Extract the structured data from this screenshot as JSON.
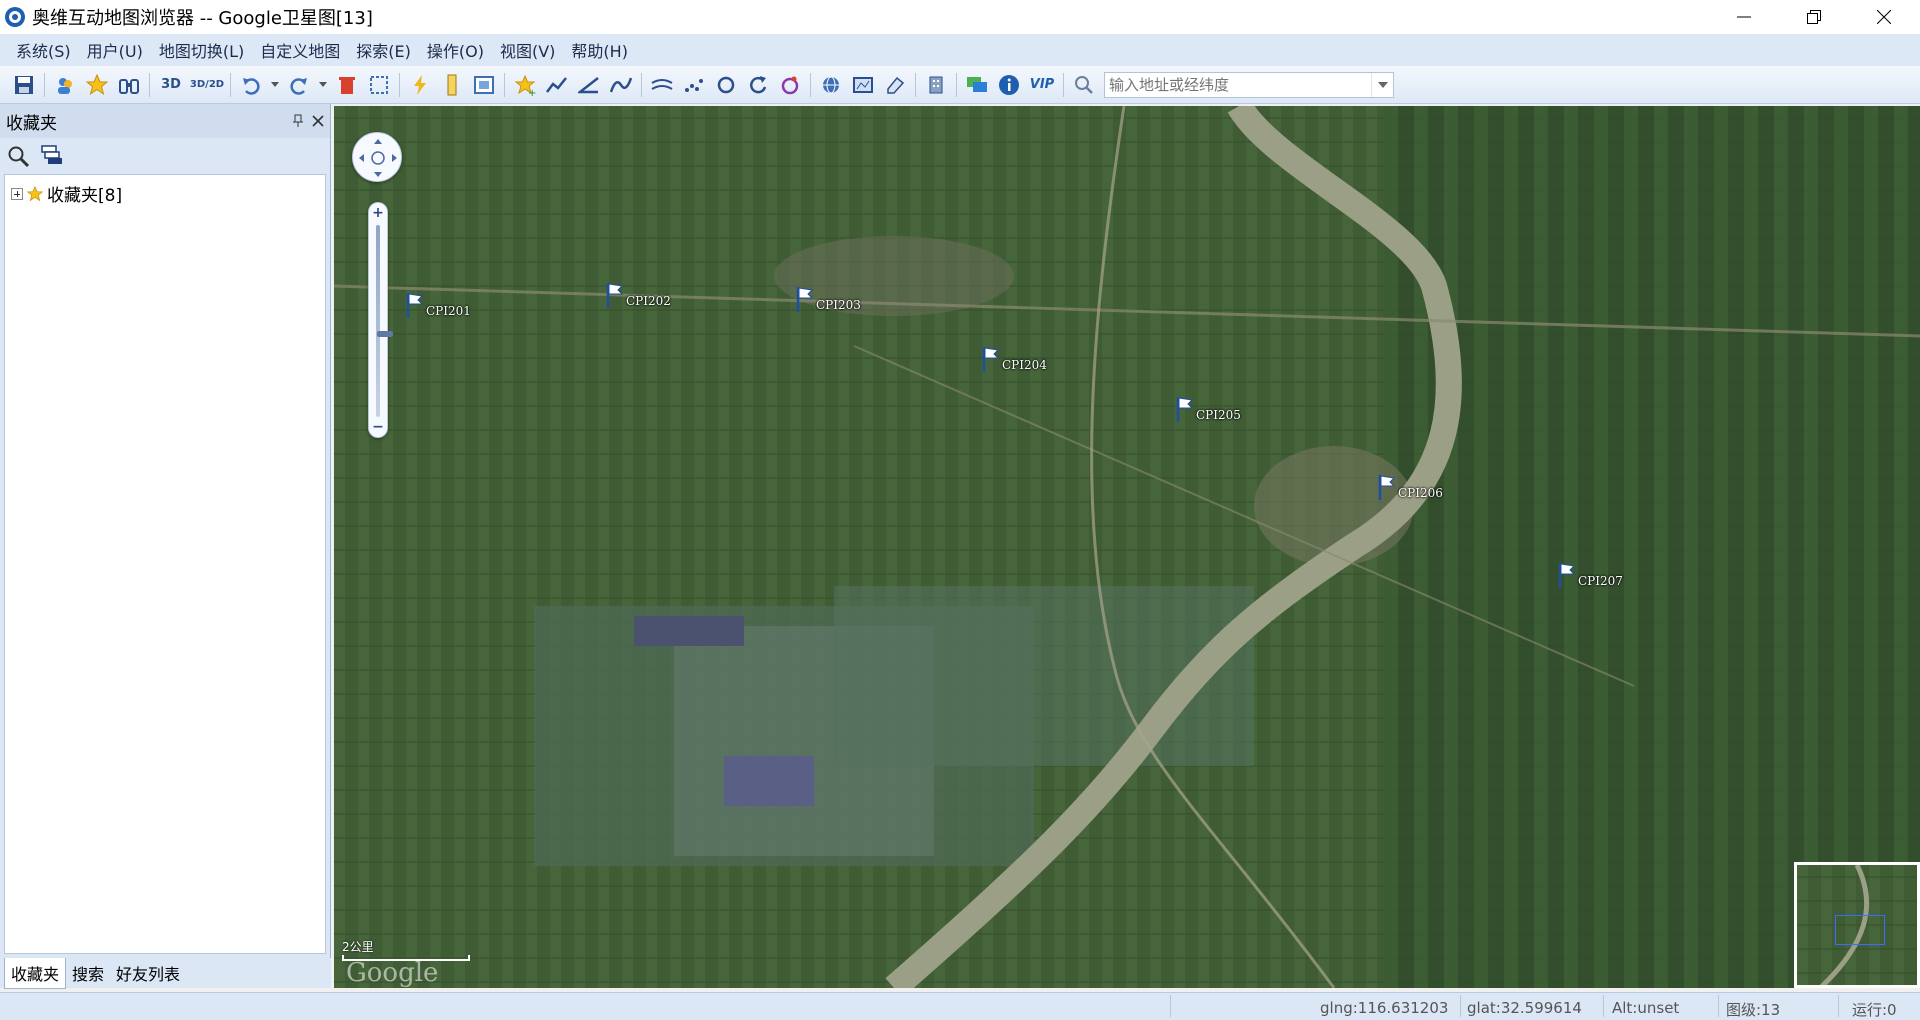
{
  "window": {
    "title": "奥维互动地图浏览器 -- Google卫星图[13]"
  },
  "menu": [
    "系统(S)",
    "用户(U)",
    "地图切换(L)",
    "自定义地图",
    "探索(E)",
    "操作(O)",
    "视图(V)",
    "帮助(H)"
  ],
  "toolbar": {
    "label_3d": "3D",
    "label_3d2d": "3D/2D",
    "label_vip": "VIP",
    "search_placeholder": "输入地址或经纬度"
  },
  "panel": {
    "title": "收藏夹",
    "tree_root": "收藏夹[8]",
    "tabs": [
      "收藏夹",
      "搜索",
      "好友列表"
    ]
  },
  "map": {
    "markers": [
      {
        "label": "CPI201"
      },
      {
        "label": "CPI202"
      },
      {
        "label": "CPI203"
      },
      {
        "label": "CPI204"
      },
      {
        "label": "CPI205"
      },
      {
        "label": "CPI206"
      },
      {
        "label": "CPI207"
      }
    ],
    "scale_label": "2公里",
    "logo": "Google"
  },
  "status": {
    "lng": "glng:116.631203",
    "lat": "glat:32.599614",
    "alt": "Alt:unset",
    "level": "图级:13",
    "run": "运行:0"
  },
  "colors": {
    "menubar": "#dde8f6",
    "map_green": "#3e5a34",
    "river": "#9a9f86",
    "marker_flag": "#1f4fa0"
  }
}
